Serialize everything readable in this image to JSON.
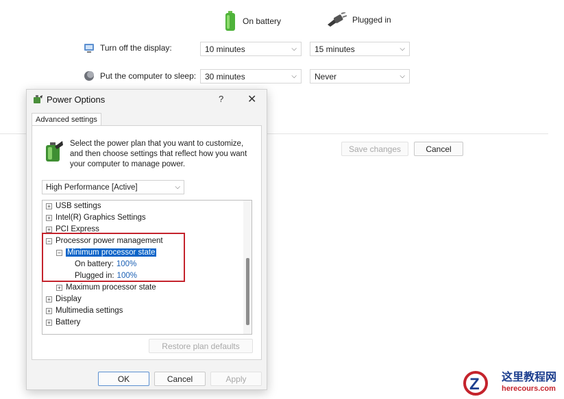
{
  "plan_settings": {
    "col_on_battery": "On battery",
    "col_plugged_in": "Plugged in",
    "rows": [
      {
        "label": "Turn off the display:",
        "on_battery": "10 minutes",
        "plugged_in": "15 minutes"
      },
      {
        "label": "Put the computer to sleep:",
        "on_battery": "30 minutes",
        "plugged_in": "Never"
      }
    ],
    "save_label": "Save changes",
    "cancel_label": "Cancel"
  },
  "dialog": {
    "title": "Power Options",
    "help": "?",
    "close": "✕",
    "tab": "Advanced settings",
    "intro": "Select the power plan that you want to customize, and then choose settings that reflect how you want your computer to manage power.",
    "plan_selected": "High Performance [Active]",
    "tree": [
      {
        "label": "USB settings",
        "toggle": "+"
      },
      {
        "label": "Intel(R) Graphics Settings",
        "toggle": "+"
      },
      {
        "label": "PCI Express",
        "toggle": "+"
      },
      {
        "label": "Processor power management",
        "toggle": "−"
      },
      {
        "label": "Minimum processor state",
        "toggle": "−"
      },
      {
        "label": "On battery:",
        "value": "100%"
      },
      {
        "label": "Plugged in:",
        "value": "100%"
      },
      {
        "label": "Maximum processor state",
        "toggle": "+"
      },
      {
        "label": "Display",
        "toggle": "+"
      },
      {
        "label": "Multimedia settings",
        "toggle": "+"
      },
      {
        "label": "Battery",
        "toggle": "+"
      }
    ],
    "restore_label": "Restore plan defaults",
    "ok_label": "OK",
    "cancel_label": "Cancel",
    "apply_label": "Apply"
  },
  "watermark": {
    "title": "这里教程网",
    "url": "herecours.com"
  },
  "colors": {
    "selection": "#0a64c8",
    "highlight_box": "#c4232c",
    "value_link": "#1a5fb4"
  }
}
